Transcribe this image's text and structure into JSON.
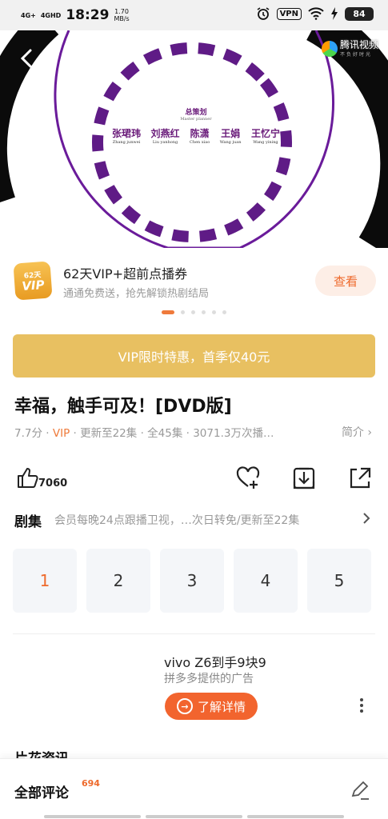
{
  "status_bar": {
    "net1": "4G+",
    "net2": "4GHD",
    "time": "18:29",
    "speed_value": "1.70",
    "speed_unit": "MB/s",
    "vpn": "VPN",
    "battery": "84"
  },
  "player": {
    "logo_text": "腾讯视频",
    "logo_sub": "不负好时光",
    "credits": {
      "role": "总策划",
      "role_en": "Master planner",
      "names": [
        "张珺玮",
        "刘燕红",
        "陈潇",
        "王娟",
        "王忆宁"
      ],
      "pinyin": [
        "Zhang junwei",
        "Liu yanhong",
        "Chen xiao",
        "Wang juan",
        "Wang yining"
      ]
    }
  },
  "vip_banner": {
    "badge_days": "62天",
    "badge_label": "VIP",
    "title": "62天VIP+超前点播券",
    "subtitle": "通通免费送，抢先解锁热剧结局",
    "button": "查看"
  },
  "promo_bar": {
    "label": "VIP限时特惠，首季仅40元"
  },
  "show": {
    "title": "幸福，触手可及！[DVD版]",
    "score": "7.7分",
    "vip": "VIP",
    "update": "更新至22集",
    "total": "全45集",
    "plays": "3071.3万次播…",
    "intro": "简介",
    "like_count": "7060"
  },
  "episodes": {
    "heading": "剧集",
    "description": "会员每晚24点跟播卫视，…次日转免/更新至22集",
    "items": [
      "1",
      "2",
      "3",
      "4",
      "5"
    ]
  },
  "ad": {
    "title": "vivo Z6到手9块9",
    "source": "拼多多提供的广告",
    "button": "了解详情"
  },
  "section_next": "片花资讯",
  "comments": {
    "label": "全部评论",
    "count": "694"
  }
}
